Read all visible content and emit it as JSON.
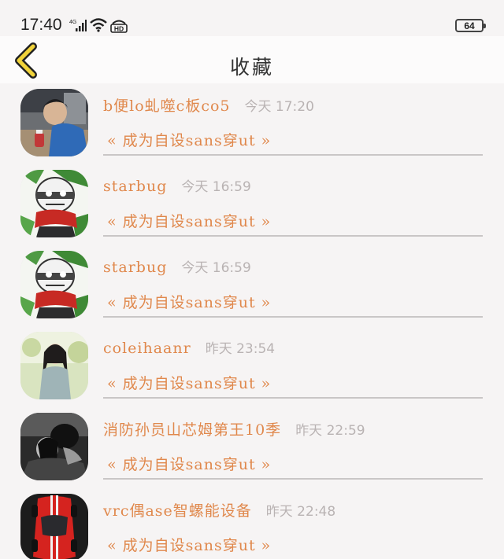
{
  "status_bar": {
    "time": "17:40",
    "network": "4G",
    "hd": "HD",
    "battery": "64",
    "icons": [
      "signal-icon",
      "wifi-icon",
      "hd-icon",
      "battery-icon"
    ]
  },
  "header": {
    "title": "收藏",
    "back_icon": "chevron-left-icon"
  },
  "colors": {
    "accent_orange": "#e0884c",
    "back_yellow": "#f1d33a",
    "time_gray": "#b9b3b3"
  },
  "favorites": [
    {
      "name": "b便lo虬噬c板co5",
      "time": "今天 17:20",
      "quote": "« 成为自设sans穿ut »",
      "avatar": "photo-boy-blue-shirt"
    },
    {
      "name": "starbug",
      "time": "今天 16:59",
      "quote": "« 成为自设sans穿ut »",
      "avatar": "skeleton-red-scarf"
    },
    {
      "name": "starbug",
      "time": "今天 16:59",
      "quote": "« 成为自设sans穿ut »",
      "avatar": "skeleton-red-scarf"
    },
    {
      "name": "coleihaanr",
      "time": "昨天 23:54",
      "quote": "« 成为自设sans穿ut »",
      "avatar": "photo-girl-outdoor"
    },
    {
      "name": "消防孙员山芯姆第王10季",
      "time": "昨天 22:59",
      "quote": "« 成为自设sans穿ut »",
      "avatar": "photo-couple-bw"
    },
    {
      "name": "vrc偶ase智螺能设备",
      "time": "昨天 22:48",
      "quote": "« 成为自设sans穿ut »",
      "avatar": "red-sports-car"
    }
  ]
}
